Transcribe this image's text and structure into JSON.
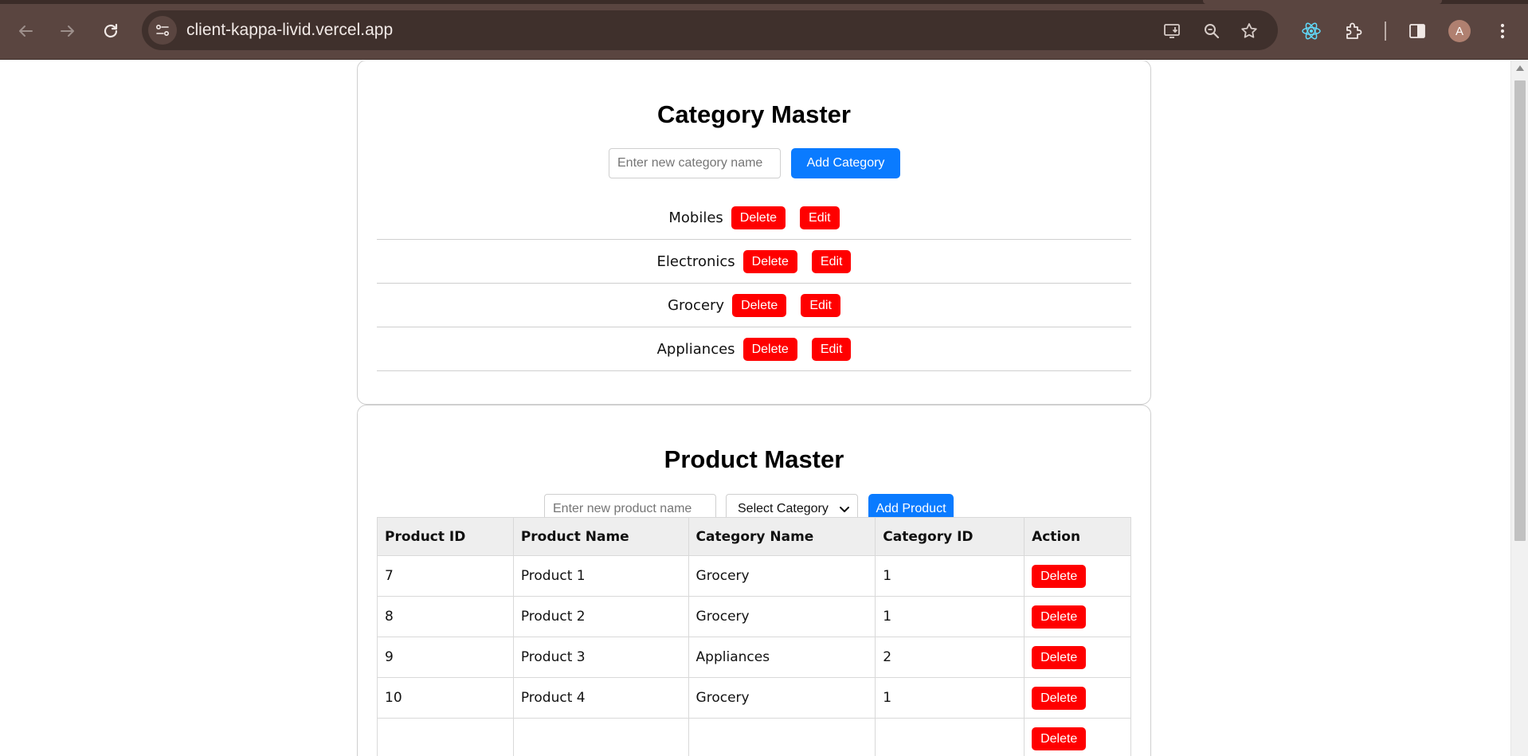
{
  "browser": {
    "url": "client-kappa-livid.vercel.app",
    "avatar_letter": "A",
    "icons": [
      "back-arrow-icon",
      "forward-arrow-icon",
      "reload-icon",
      "site-info-icon",
      "install-app-icon",
      "zoom-icon",
      "bookmark-star-icon",
      "react-devtools-icon",
      "extensions-puzzle-icon",
      "side-panel-icon",
      "menu-dots-icon"
    ]
  },
  "category_master": {
    "title": "Category Master",
    "input_placeholder": "Enter new category name",
    "add_button": "Add Category",
    "delete_label": "Delete",
    "edit_label": "Edit",
    "categories": [
      "Mobiles",
      "Electronics",
      "Grocery",
      "Appliances"
    ]
  },
  "product_master": {
    "title": "Product Master",
    "input_placeholder": "Enter new product name",
    "select_value": "Select Category",
    "add_button": "Add Product",
    "columns": [
      "Product ID",
      "Product Name",
      "Category Name",
      "Category ID",
      "Action"
    ],
    "delete_label": "Delete",
    "rows": [
      {
        "id": "7",
        "name": "Product 1",
        "category": "Grocery",
        "category_id": "1"
      },
      {
        "id": "8",
        "name": "Product 2",
        "category": "Grocery",
        "category_id": "1"
      },
      {
        "id": "9",
        "name": "Product 3",
        "category": "Appliances",
        "category_id": "2"
      },
      {
        "id": "10",
        "name": "Product 4",
        "category": "Grocery",
        "category_id": "1"
      },
      {
        "id": "",
        "name": "",
        "category": "",
        "category_id": ""
      }
    ]
  },
  "colors": {
    "primary_button": "#0a7bff",
    "danger_button": "#ff0000",
    "chrome_bar": "#5a4540",
    "table_header_bg": "#eeeeee"
  }
}
